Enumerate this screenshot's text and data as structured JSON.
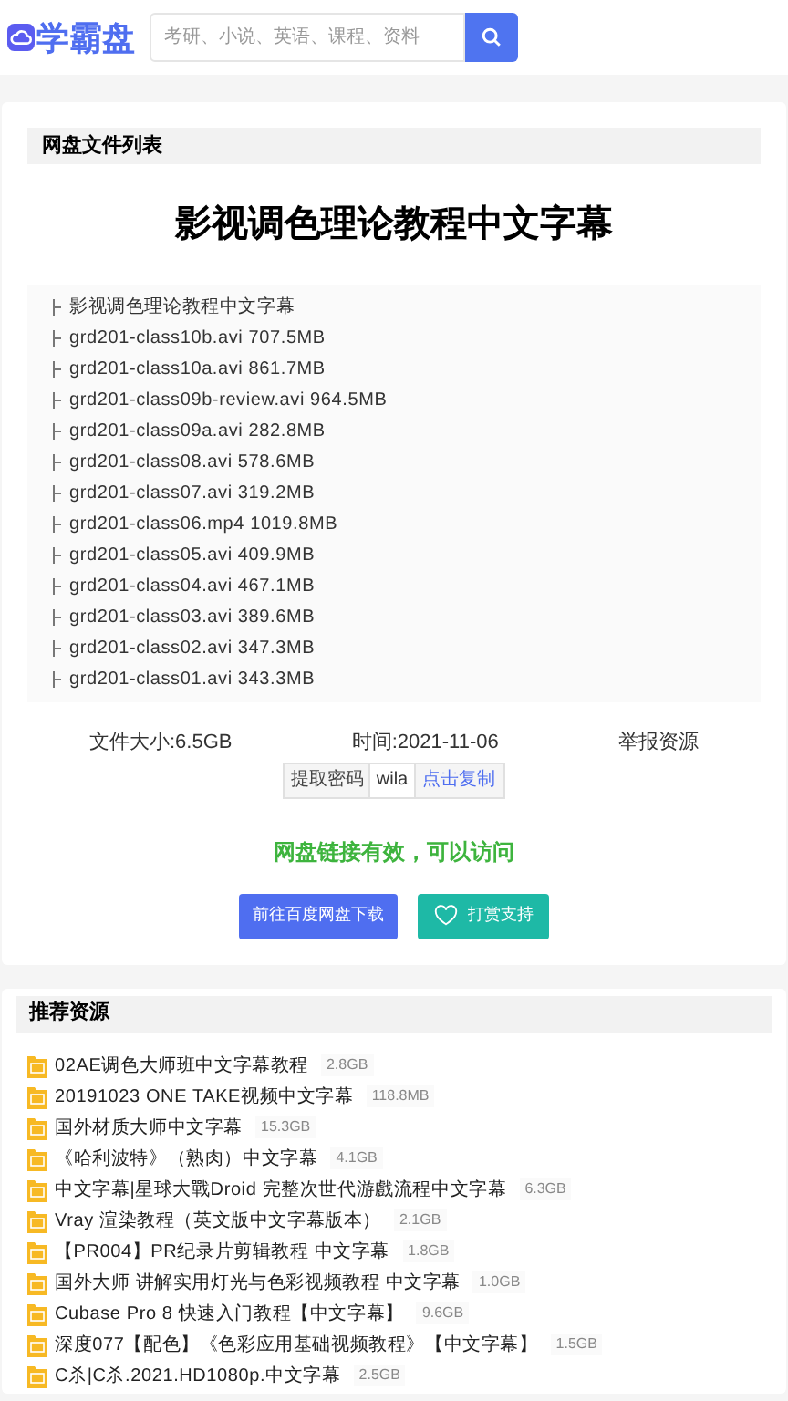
{
  "header": {
    "logo": "学霸盘",
    "search": {
      "placeholder": "考研、小说、英语、课程、资料"
    }
  },
  "file_panel": {
    "heading": "网盘文件列表",
    "title": "影视调色理论教程中文字幕",
    "files": [
      "影视调色理论教程中文字幕",
      "grd201-class10b.avi 707.5MB",
      "grd201-class10a.avi 861.7MB",
      "grd201-class09b-review.avi 964.5MB",
      "grd201-class09a.avi 282.8MB",
      "grd201-class08.avi 578.6MB",
      "grd201-class07.avi 319.2MB",
      "grd201-class06.mp4 1019.8MB",
      "grd201-class05.avi 409.9MB",
      "grd201-class04.avi 467.1MB",
      "grd201-class03.avi 389.6MB",
      "grd201-class02.avi 347.3MB",
      "grd201-class01.avi 343.3MB"
    ],
    "size": "文件大小:6.5GB",
    "time": "时间:2021-11-06",
    "report": "举报资源",
    "password": {
      "label": "提取密码",
      "code": "wila",
      "copy": "点击复制"
    },
    "status": "网盘链接有效，可以访问",
    "download": "前往百度网盘下载",
    "donate": "打赏支持"
  },
  "recommend": {
    "heading": "推荐资源",
    "items": [
      {
        "name": "02AE调色大师班中文字幕教程",
        "size": "2.8GB"
      },
      {
        "name": "20191023 ONE TAKE视频中文字幕",
        "size": "118.8MB"
      },
      {
        "name": "国外材质大师中文字幕",
        "size": "15.3GB"
      },
      {
        "name": "《哈利波特》（熟肉）中文字幕",
        "size": "4.1GB"
      },
      {
        "name": "中文字幕|星球大戰Droid 完整次世代游戲流程中文字幕",
        "size": "6.3GB"
      },
      {
        "name": "Vray 渲染教程（英文版中文字幕版本）",
        "size": "2.1GB"
      },
      {
        "name": "【PR004】PR纪录片剪辑教程 中文字幕",
        "size": "1.8GB"
      },
      {
        "name": "国外大师 讲解实用灯光与色彩视频教程 中文字幕",
        "size": "1.0GB"
      },
      {
        "name": "Cubase Pro 8 快速入门教程【中文字幕】",
        "size": "9.6GB"
      },
      {
        "name": "深度077【配色】《色彩应用基础视频教程》【中文字幕】",
        "size": "1.5GB"
      },
      {
        "name": "C杀|C杀.2021.HD1080p.中文字幕",
        "size": "2.5GB"
      }
    ]
  }
}
